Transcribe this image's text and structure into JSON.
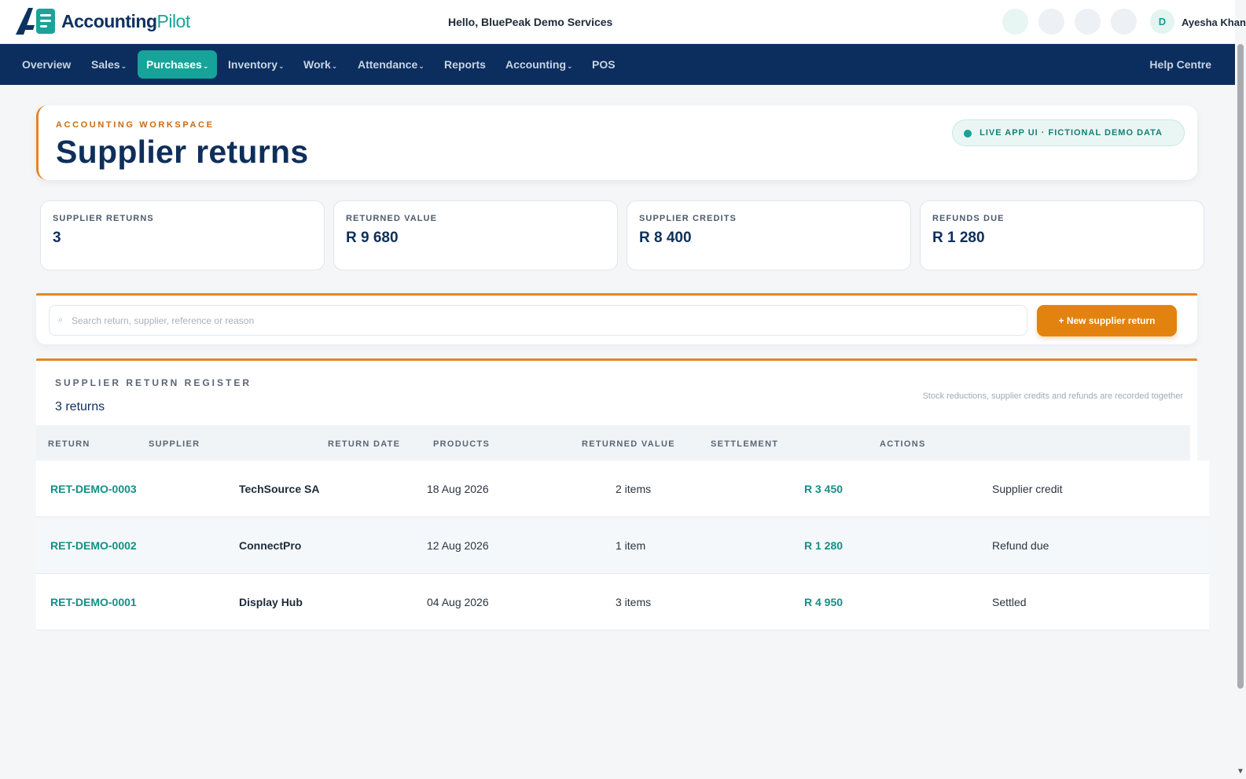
{
  "app": {
    "logo_brand": "Accounting",
    "logo_accent": "Pilot",
    "greeting": "Hello, BluePeak Demo Services",
    "avatar_initial": "D",
    "user_name": "Ayesha Khan"
  },
  "nav": {
    "items": [
      {
        "label": "Overview",
        "caret": ""
      },
      {
        "label": "Sales",
        "caret": "⌄"
      },
      {
        "label": "Purchases",
        "caret": "⌄"
      },
      {
        "label": "Inventory",
        "caret": "⌄"
      },
      {
        "label": "Work",
        "caret": "⌄"
      },
      {
        "label": "Attendance",
        "caret": "⌄"
      },
      {
        "label": "Reports",
        "caret": ""
      },
      {
        "label": "Accounting",
        "caret": "⌄"
      },
      {
        "label": "POS",
        "caret": ""
      }
    ],
    "active": "Purchases",
    "help": "Help Centre"
  },
  "header": {
    "eyebrow": "ACCOUNTING WORKSPACE",
    "title": "Supplier returns",
    "badge": "LIVE APP UI · FICTIONAL DEMO DATA"
  },
  "stats": [
    {
      "label": "SUPPLIER RETURNS",
      "value": "3"
    },
    {
      "label": "RETURNED VALUE",
      "value": "R 9 680"
    },
    {
      "label": "SUPPLIER CREDITS",
      "value": "R 8 400"
    },
    {
      "label": "REFUNDS DUE",
      "value": "R 1 280"
    }
  ],
  "search": {
    "icon": "search-icon",
    "placeholder": "Search return, supplier, reference or reason",
    "value": ""
  },
  "new_button_label": "+ New supplier return",
  "register": {
    "title": "SUPPLIER RETURN REGISTER",
    "count": "3 returns",
    "note": "Stock reductions, supplier credits and refunds are recorded together",
    "columns": [
      "RETURN",
      "SUPPLIER",
      "RETURN DATE",
      "PRODUCTS",
      "RETURNED VALUE",
      "SETTLEMENT",
      "ACTIONS"
    ],
    "rows": [
      {
        "return": "RET-DEMO-0003",
        "supplier": "TechSource SA",
        "date": "18 Aug 2026",
        "products": "2 items",
        "value": "R 3 450",
        "settlement": "Supplier credit"
      },
      {
        "return": "RET-DEMO-0002",
        "supplier": "ConnectPro",
        "date": "12 Aug 2026",
        "products": "1 item",
        "value": "R 1 280",
        "settlement": "Refund due"
      },
      {
        "return": "RET-DEMO-0001",
        "supplier": "Display Hub",
        "date": "04 Aug 2026",
        "products": "3 items",
        "value": "R 4 950",
        "settlement": "Settled"
      }
    ]
  },
  "colors": {
    "brand_navy": "#0c2e5e",
    "accent_teal": "#16a399",
    "accent_orange": "#e68521"
  }
}
